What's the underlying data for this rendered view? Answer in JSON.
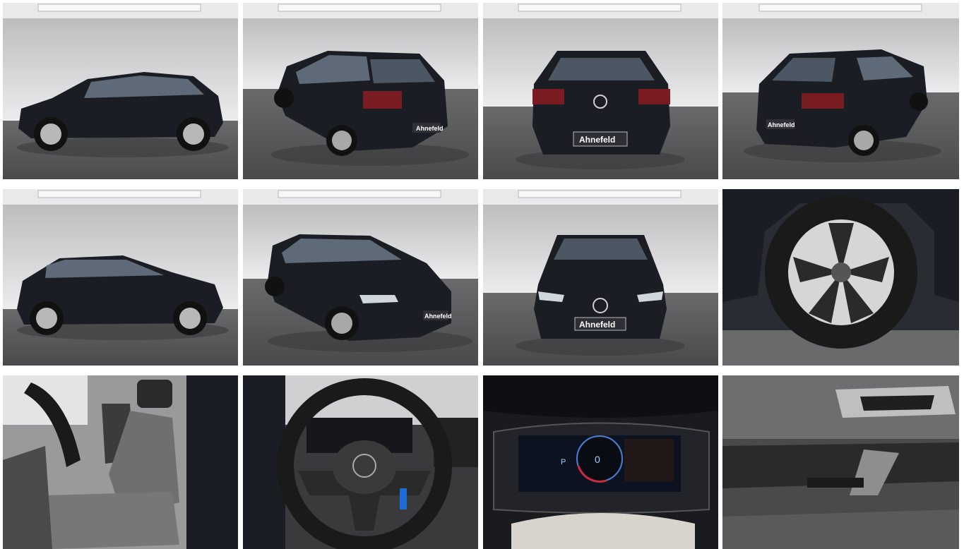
{
  "gallery": {
    "columns": 4,
    "rows": 3,
    "dealer_plate": "Ahnefeld",
    "dashboard": {
      "speed_readout": "0",
      "gear": "P"
    },
    "colors": {
      "studio_wall": "#d9d9db",
      "studio_floor": "#5b5b5d",
      "car_body": "#1b1d24",
      "interior_dark": "#2a2a2c",
      "seat_fabric": "#6f6f6f"
    },
    "photos": [
      {
        "view": "side-left"
      },
      {
        "view": "rear-three-quarter-left"
      },
      {
        "view": "rear"
      },
      {
        "view": "rear-three-quarter-right"
      },
      {
        "view": "side-right"
      },
      {
        "view": "front-three-quarter-left"
      },
      {
        "view": "front"
      },
      {
        "view": "wheel-detail"
      },
      {
        "view": "front-seats"
      },
      {
        "view": "steering-wheel"
      },
      {
        "view": "digital-cockpit"
      },
      {
        "view": "door-panel"
      }
    ]
  }
}
